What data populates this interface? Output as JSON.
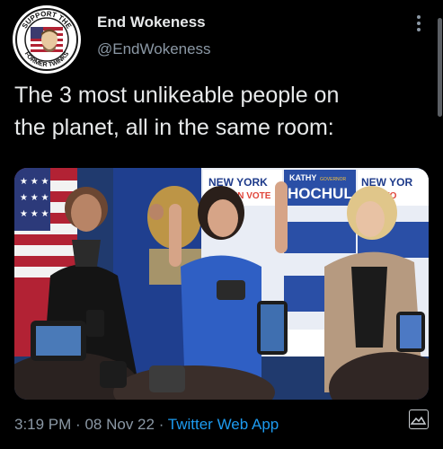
{
  "author": {
    "display_name": "End Wokeness",
    "handle": "@EndWokeness",
    "avatar_text_top": "SUPPORT THE",
    "avatar_text_bottom": "FORMER TWINKS"
  },
  "tweet": {
    "text_line1": "The 3 most unlikeable people on",
    "text_line2": "the planet, all in the same room:"
  },
  "image": {
    "sign_new_york": "NEW YORK",
    "sign_women_vote": "WOMEN VOTE",
    "sign_kathy": "KATHY",
    "sign_governor": "GOVERNOR",
    "sign_hochul": "HOCHUL",
    "sign_new_yor": "NEW YOR",
    "sign_men_vo": "MEN VO"
  },
  "footer": {
    "time": "3:19 PM",
    "separator": "·",
    "date": "08 Nov 22",
    "source": "Twitter Web App"
  },
  "colors": {
    "background": "#000000",
    "text": "#e7e9ea",
    "secondary": "#8b98a5",
    "link": "#1d9bf0"
  }
}
